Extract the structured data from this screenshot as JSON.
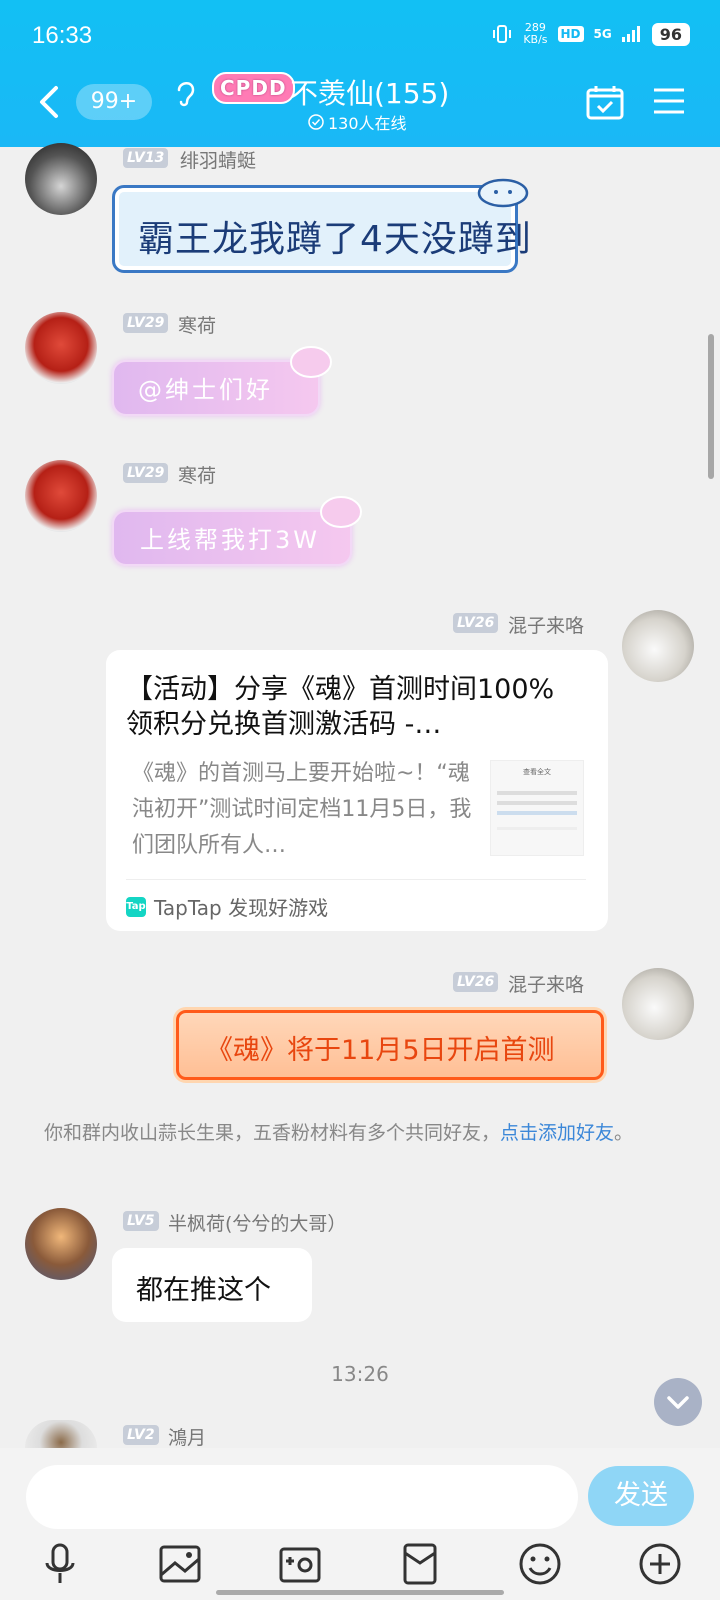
{
  "status_bar": {
    "time": "16:33",
    "speed": "289",
    "speed_unit": "KB/s",
    "hd": "HD",
    "network": "5G",
    "battery": "96"
  },
  "header": {
    "unread": "99+",
    "group_tag": "CPDD",
    "group_name": "不羡仙(155)",
    "online": "130人在线"
  },
  "messages": [
    {
      "level": "LV13",
      "name": "绯羽蜻蜓",
      "text": "霸王龙我蹲了4天没蹲到"
    },
    {
      "level": "LV29",
      "name": "寒荷",
      "text": "@绅士们好"
    },
    {
      "level": "LV29",
      "name": "寒荷",
      "text": "上线帮我打3W"
    },
    {
      "level": "LV26",
      "name": "混子来咯",
      "card": {
        "title": "【活动】分享《魂》首测时间100%领积分兑换首测激活码 -…",
        "desc": "《魂》的首测马上要开始啦~！“魂沌初开”测试时间定档11月5日，我们团队所有人…",
        "source": "TapTap 发现好游戏",
        "source_logo": "Tap",
        "thumb_title": "查看全文"
      }
    },
    {
      "level": "LV26",
      "name": "混子来咯",
      "text": "《魂》将于11月5日开启首测"
    },
    {
      "level": "LV5",
      "name": "半枫荷(兮兮的大哥）",
      "text": "都在推这个"
    },
    {
      "level": "LV2",
      "name": "鴻月"
    }
  ],
  "notice": {
    "text": "你和群内收山蒜长生果，五香粉材料有多个共同好友，",
    "link": "点击添加好友",
    "end": "。"
  },
  "time_separator": "13:26",
  "composer": {
    "send": "发送"
  },
  "colors": {
    "header": "#12c0f4",
    "accent_link": "#3b87d8",
    "send": "#8fd6f6"
  }
}
